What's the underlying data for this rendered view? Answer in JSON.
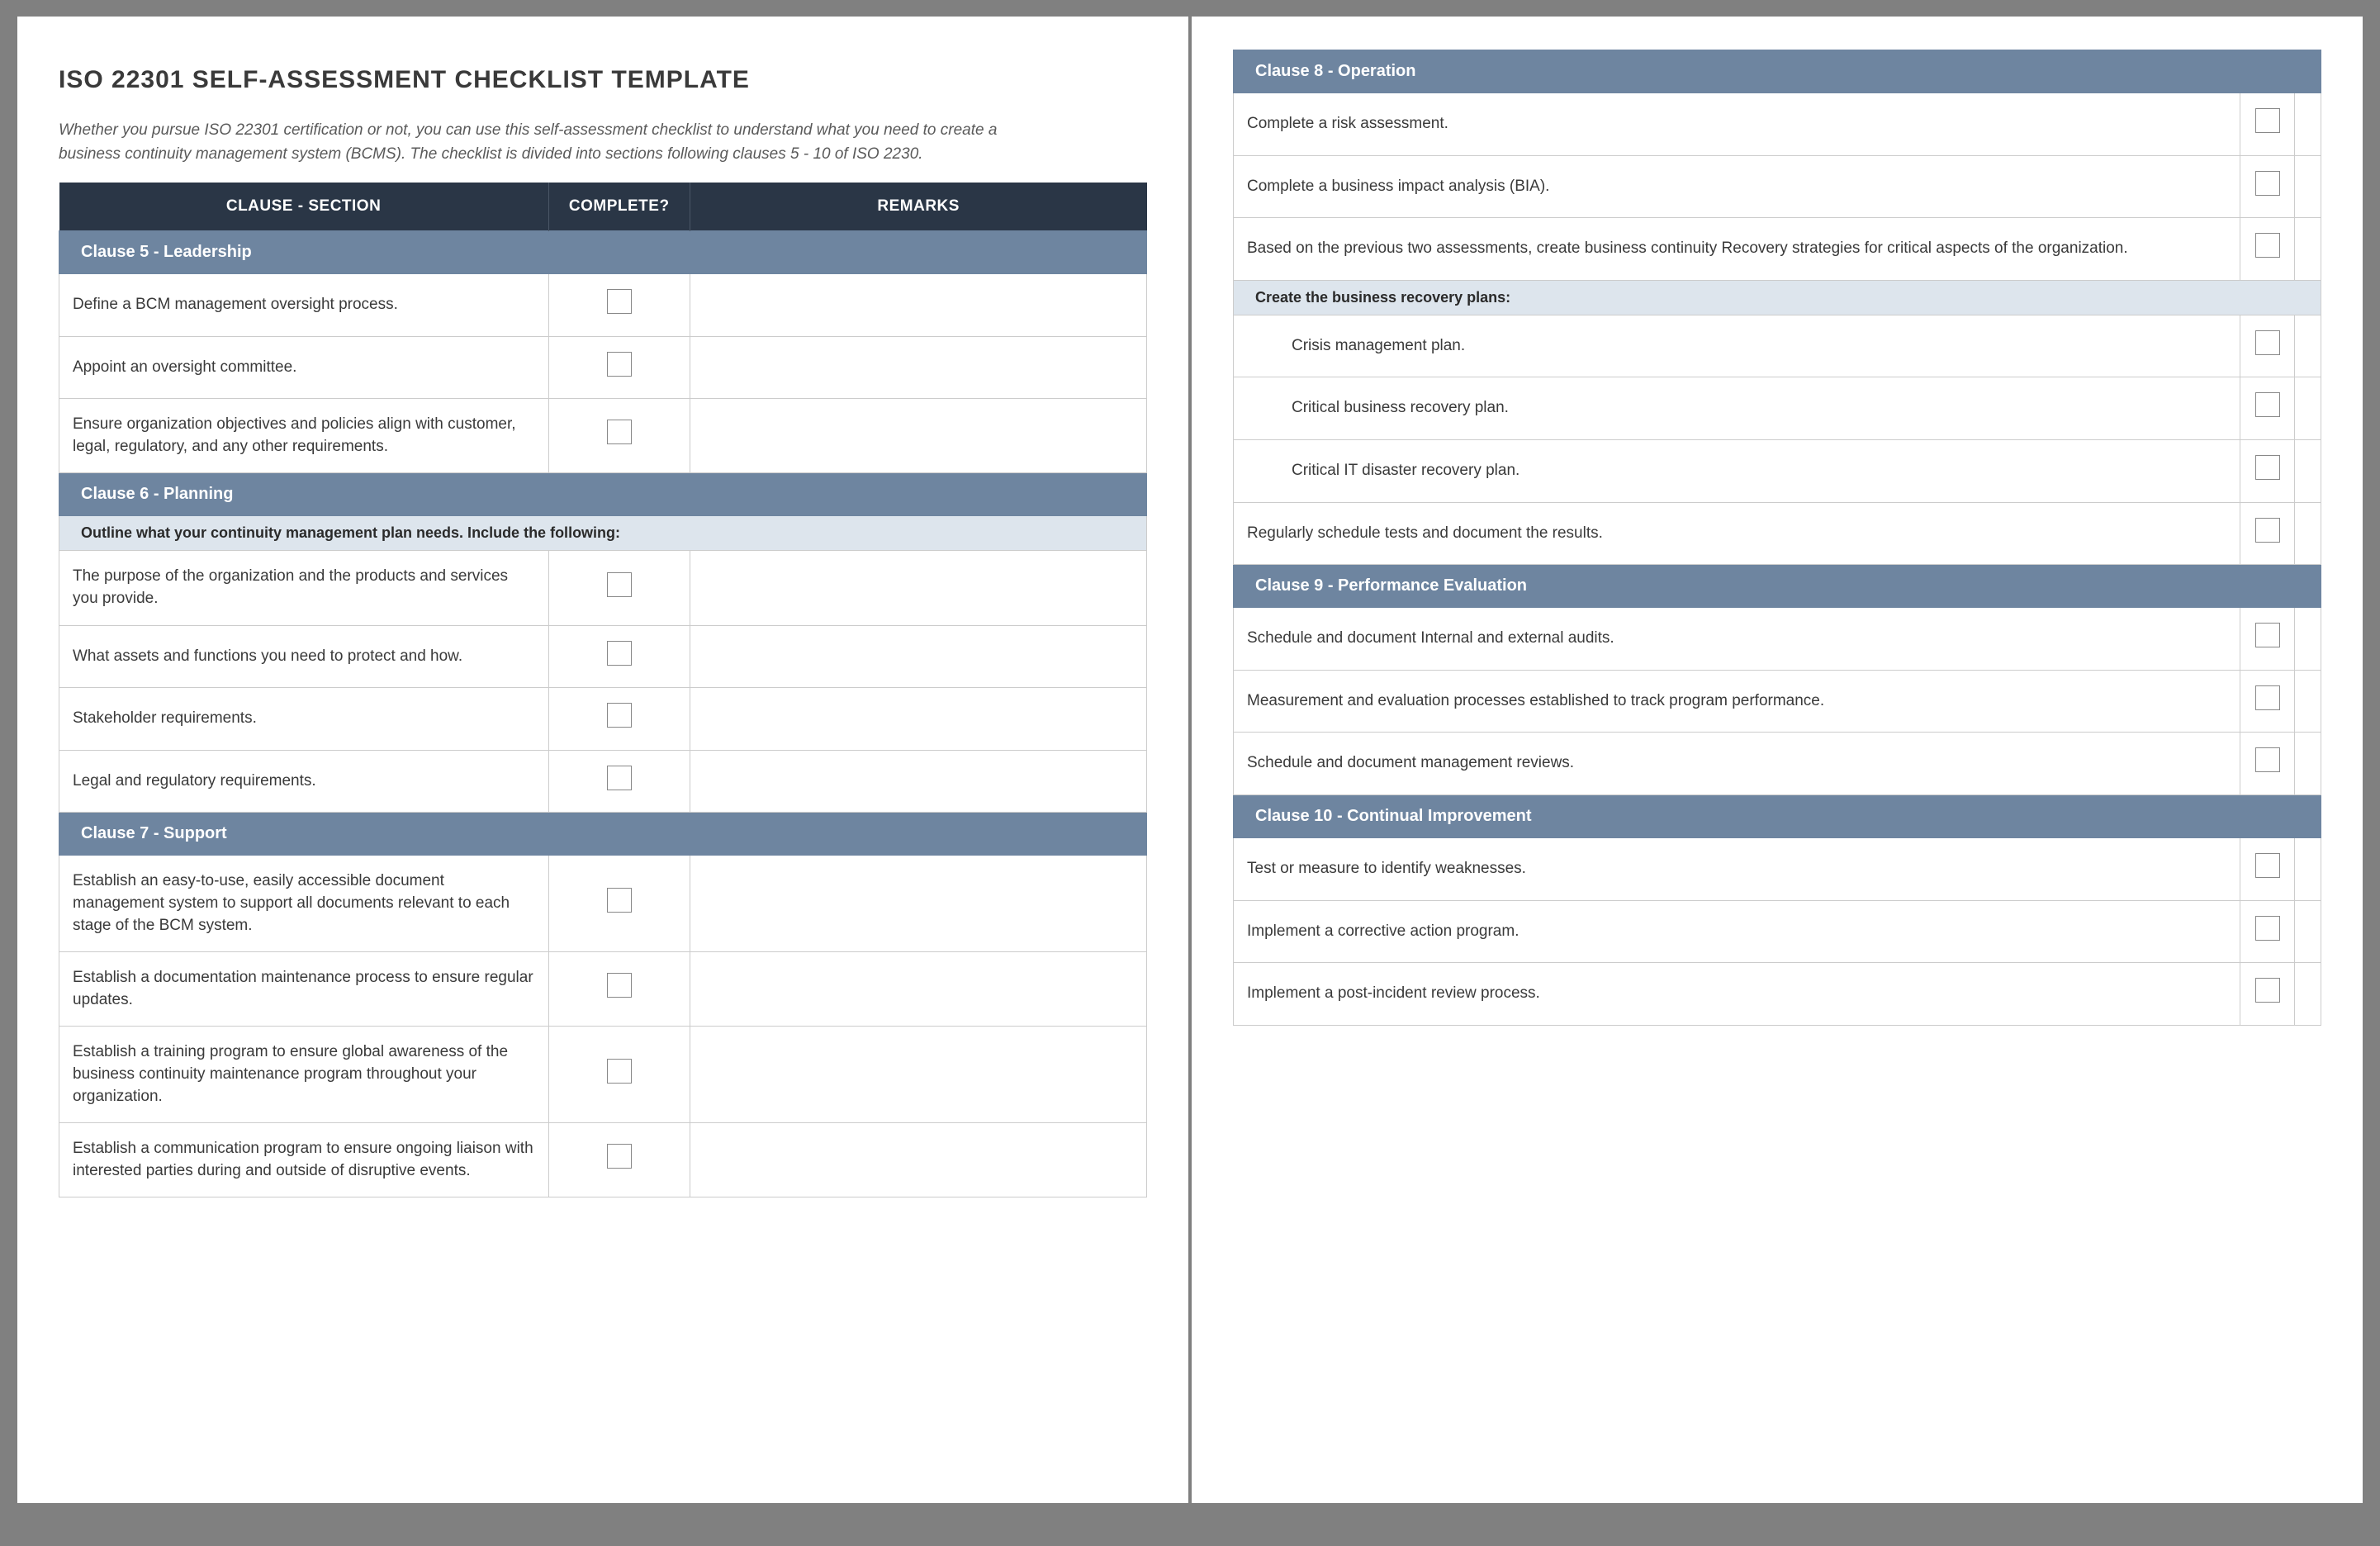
{
  "title": "ISO 22301 SELF-ASSESSMENT CHECKLIST TEMPLATE",
  "intro": "Whether you pursue ISO 22301 certification or not, you can use this self-assessment checklist to understand what you need to create a business continuity management system (BCMS). The checklist is divided into sections following clauses 5 - 10 of ISO 2230.",
  "headers": {
    "clause": "CLAUSE - SECTION",
    "complete": "COMPLETE?",
    "remarks": "REMARKS"
  },
  "page1": [
    {
      "type": "section",
      "label": "Clause 5 - Leadership"
    },
    {
      "type": "item",
      "label": "Define a BCM management oversight process."
    },
    {
      "type": "item",
      "label": "Appoint an oversight committee."
    },
    {
      "type": "item",
      "label": "Ensure organization objectives and policies align with customer, legal, regulatory, and any other requirements."
    },
    {
      "type": "section",
      "label": "Clause 6 - Planning"
    },
    {
      "type": "sub",
      "label": "Outline what your continuity management plan needs. Include the following:"
    },
    {
      "type": "item",
      "label": "The purpose of the organization and the products and services you provide."
    },
    {
      "type": "item",
      "label": "What assets and functions you need to protect and how."
    },
    {
      "type": "item",
      "label": "Stakeholder requirements."
    },
    {
      "type": "item",
      "label": "Legal and regulatory requirements."
    },
    {
      "type": "section",
      "label": "Clause 7 - Support"
    },
    {
      "type": "item",
      "label": "Establish an easy-to-use, easily accessible document management system to support all documents relevant to each stage of the BCM system."
    },
    {
      "type": "item",
      "label": "Establish a documentation maintenance process to ensure regular updates."
    },
    {
      "type": "item",
      "label": "Establish a training program to ensure global awareness of the business continuity maintenance program throughout your organization."
    },
    {
      "type": "item",
      "label": "Establish a communication program to ensure ongoing liaison with interested parties during and outside of disruptive events."
    }
  ],
  "page2": [
    {
      "type": "section",
      "label": "Clause 8 - Operation"
    },
    {
      "type": "item",
      "label": "Complete a risk assessment."
    },
    {
      "type": "item",
      "label": "Complete a business impact analysis (BIA)."
    },
    {
      "type": "item",
      "label": "Based on the previous two assessments, create business continuity Recovery strategies for critical aspects of the organization."
    },
    {
      "type": "sub",
      "label": "Create the business recovery plans:"
    },
    {
      "type": "item",
      "label": "Crisis management plan.",
      "indent": true
    },
    {
      "type": "item",
      "label": "Critical business recovery plan.",
      "indent": true
    },
    {
      "type": "item",
      "label": "Critical IT disaster recovery plan.",
      "indent": true
    },
    {
      "type": "item",
      "label": "Regularly schedule tests and document the results."
    },
    {
      "type": "section",
      "label": "Clause 9 - Performance Evaluation"
    },
    {
      "type": "item",
      "label": "Schedule and document Internal and external audits."
    },
    {
      "type": "item",
      "label": "Measurement and evaluation processes established to track program performance."
    },
    {
      "type": "item",
      "label": "Schedule and document management reviews."
    },
    {
      "type": "section",
      "label": "Clause 10 - Continual Improvement"
    },
    {
      "type": "item",
      "label": "Test or measure to identify weaknesses."
    },
    {
      "type": "item",
      "label": "Implement a corrective action program."
    },
    {
      "type": "item",
      "label": "Implement a post-incident review process."
    }
  ]
}
